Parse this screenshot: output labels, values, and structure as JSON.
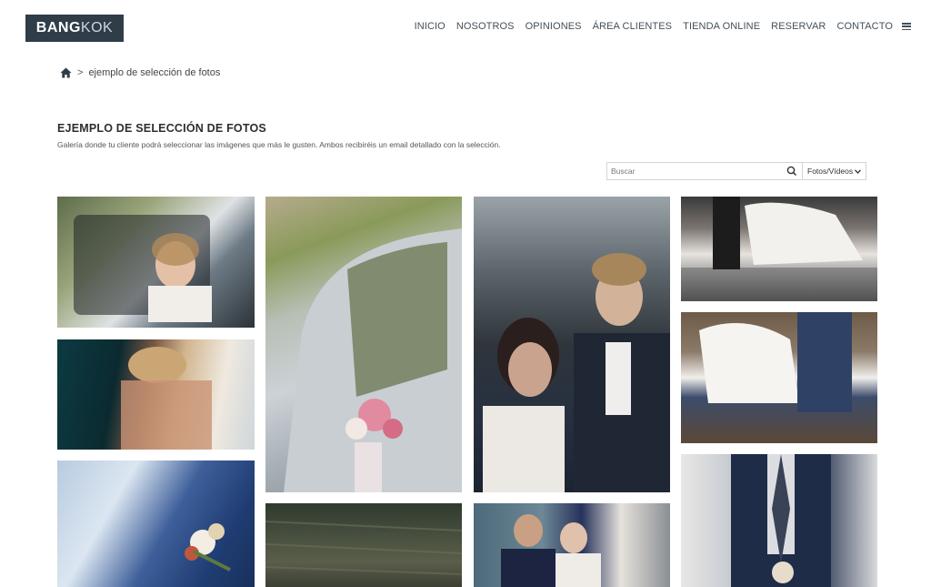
{
  "header": {
    "logo": {
      "bold": "BANG",
      "light": "KOK"
    },
    "nav": [
      "INICIO",
      "NOSOTROS",
      "OPINIONES",
      "ÁREA CLIENTES",
      "TIENDA ONLINE",
      "RESERVAR",
      "CONTACTO"
    ]
  },
  "breadcrumb": {
    "separator": ">",
    "current": "ejemplo de selección de fotos"
  },
  "page": {
    "title": "EJEMPLO DE SELECCIÓN DE FOTOS",
    "description": "Galería donde tu cliente podrá seleccionar las imágenes que más le gusten. Ambos recibiréis un email detallado con la selección."
  },
  "toolbar": {
    "search_placeholder": "Buscar",
    "filter_selected": "Fotos/Vídeos"
  },
  "icons": {
    "home": "home-icon",
    "search": "search-icon",
    "menu": "hamburger-menu-icon",
    "dropdown": "chevron-down-icon"
  },
  "colors": {
    "logo_bg": "#2f3d49",
    "nav_text": "#44505a"
  }
}
